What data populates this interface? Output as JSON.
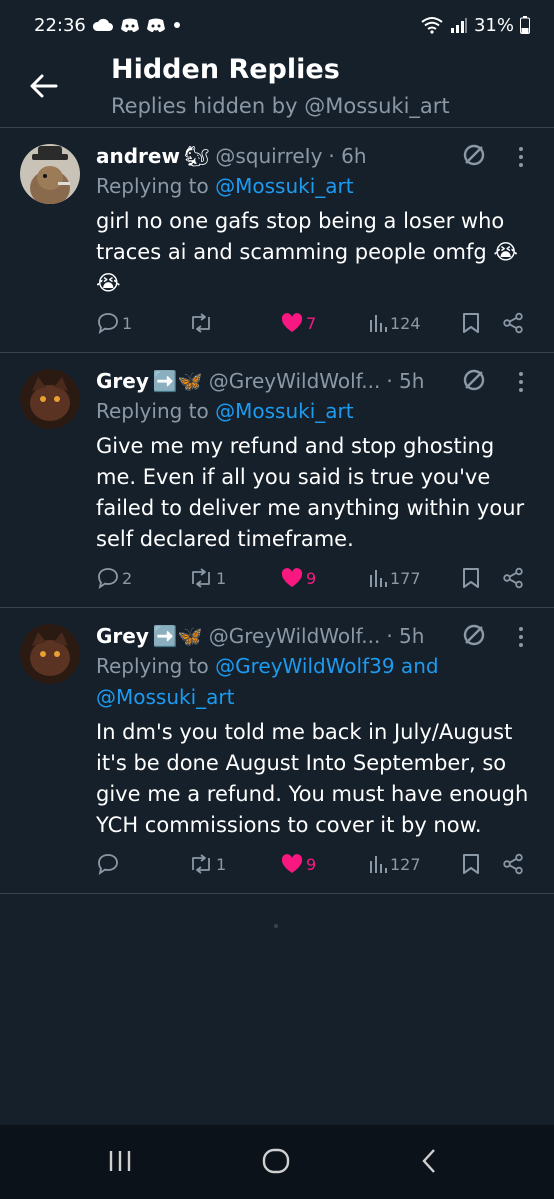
{
  "status_bar": {
    "time": "22:36",
    "battery": "31%"
  },
  "header": {
    "title": "Hidden Replies",
    "subtitle": "Replies hidden by @Mossuki_art"
  },
  "tweets": [
    {
      "name": "andrew",
      "name_emoji": "🐿",
      "handle": "@squirreIy",
      "time": "· 6h",
      "replying_prefix": "Replying to",
      "replying_to": "@Mossuki_art",
      "replying_extra": "",
      "body": "girl no one gafs stop being a loser who traces ai and scamming people omfg 😭😭",
      "replies": "1",
      "retweets": "",
      "likes": "7",
      "views": "124"
    },
    {
      "name": "Grey",
      "name_emoji": "➡️🦋",
      "handle": "@GreyWildWolf...",
      "time": "· 5h",
      "replying_prefix": "Replying to",
      "replying_to": "@Mossuki_art",
      "replying_extra": "",
      "body": "Give me my refund and stop ghosting me. Even if all you said is true you've failed to deliver me anything within your self declared timeframe.",
      "replies": "2",
      "retweets": "1",
      "likes": "9",
      "views": "177"
    },
    {
      "name": "Grey",
      "name_emoji": "➡️🦋",
      "handle": "@GreyWildWolf...",
      "time": "· 5h",
      "replying_prefix": "Replying to",
      "replying_to": "@GreyWildWolf39 and",
      "replying_extra": "@Mossuki_art",
      "body": "In dm's you told me back in July/August it's be done August Into September, so give me a refund. You must have enough YCH commissions to cover it by now.",
      "replies": "",
      "retweets": "1",
      "likes": "9",
      "views": "127"
    }
  ],
  "colors": {
    "background": "#15202b",
    "secondary_text": "#8b98a5",
    "link": "#1d9bf0",
    "like": "#f91880",
    "divider": "#38444d"
  },
  "icons": {
    "back": "arrow-left-icon",
    "hide": "hidden-reply-icon",
    "more": "more-vertical-icon",
    "reply": "comment-icon",
    "retweet": "retweet-icon",
    "like": "heart-icon",
    "views": "analytics-icon",
    "bookmark": "bookmark-icon",
    "share": "share-icon"
  }
}
